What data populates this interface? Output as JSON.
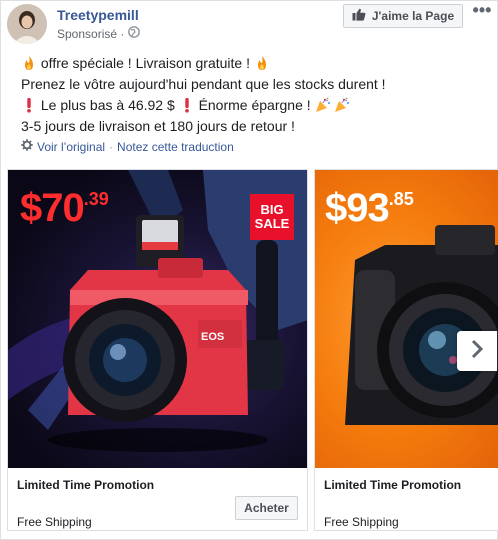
{
  "header": {
    "page_name": "Treetypemill",
    "sponsored_label": "Sponsorisé ·",
    "like_button_label": "J'aime la Page",
    "more_label": "•••"
  },
  "post_text": {
    "line1": "offre spéciale ! Livraison gratuite !",
    "line2": "Prenez le vôtre aujourd'hui pendant que les stocks durent !",
    "line3a": "Le plus bas à 46.92 $",
    "line3b": "Énorme épargne !",
    "line4": "3-5 jours de livraison et 180 jours de retour !"
  },
  "translation": {
    "see_original": "Voir l’original",
    "separator": "·",
    "rate_translation": "Notez cette traduction"
  },
  "cards": [
    {
      "price_main": "$70",
      "price_cents": ".39",
      "badge_line1": "BIG",
      "badge_line2": "SALE",
      "camera_brand": "EOS",
      "title": "Limited Time Promotion",
      "subtitle": "Free Shipping",
      "cta": "Acheter"
    },
    {
      "price_main": "$93",
      "price_cents": ".85",
      "title": "Limited Time Promotion",
      "subtitle": "Free Shipping"
    }
  ],
  "colors": {
    "link": "#385898",
    "price_red": "#ff2d2d",
    "sale_red": "#e8102a",
    "card2_orange": "#f47a0c"
  },
  "icons": [
    "fire-icon",
    "exclamation-icon",
    "party-popper-icon",
    "globe-icon",
    "thumbs-up-icon",
    "gear-icon",
    "chevron-right-icon"
  ]
}
